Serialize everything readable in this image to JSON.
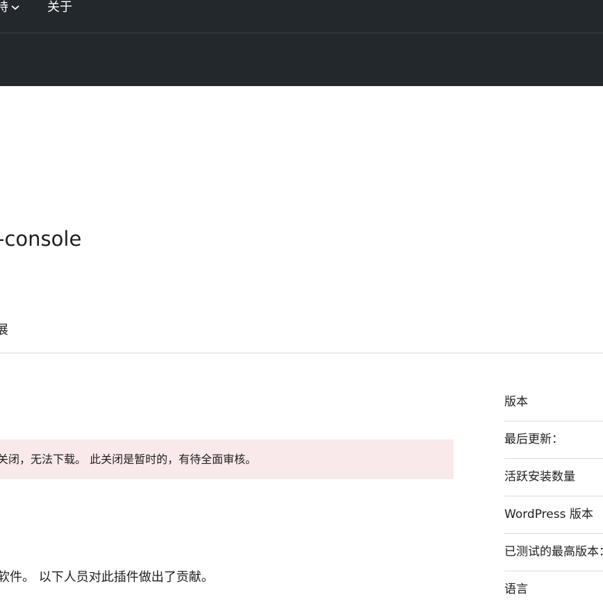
{
  "nav": {
    "support_label": "持",
    "about_label": "关于"
  },
  "plugin": {
    "title": "-console"
  },
  "tabs": {
    "current_label": "展"
  },
  "notice": {
    "text": "关闭，无法下载。 此关闭是暂时的，有待全面审核。",
    "background": "#fae9ea"
  },
  "contributors": {
    "text": "软件。 以下人员对此插件做出了贡献。"
  },
  "meta": {
    "items": [
      {
        "label": "版本"
      },
      {
        "label": "最后更新："
      },
      {
        "label": "活跃安装数量"
      },
      {
        "label": "WordPress 版本"
      },
      {
        "label": "已测试的最高版本："
      },
      {
        "label": "语言"
      }
    ]
  },
  "colors": {
    "nav_background": "#23282d",
    "text": "#1e1e1e",
    "divider": "#dcdcde"
  }
}
